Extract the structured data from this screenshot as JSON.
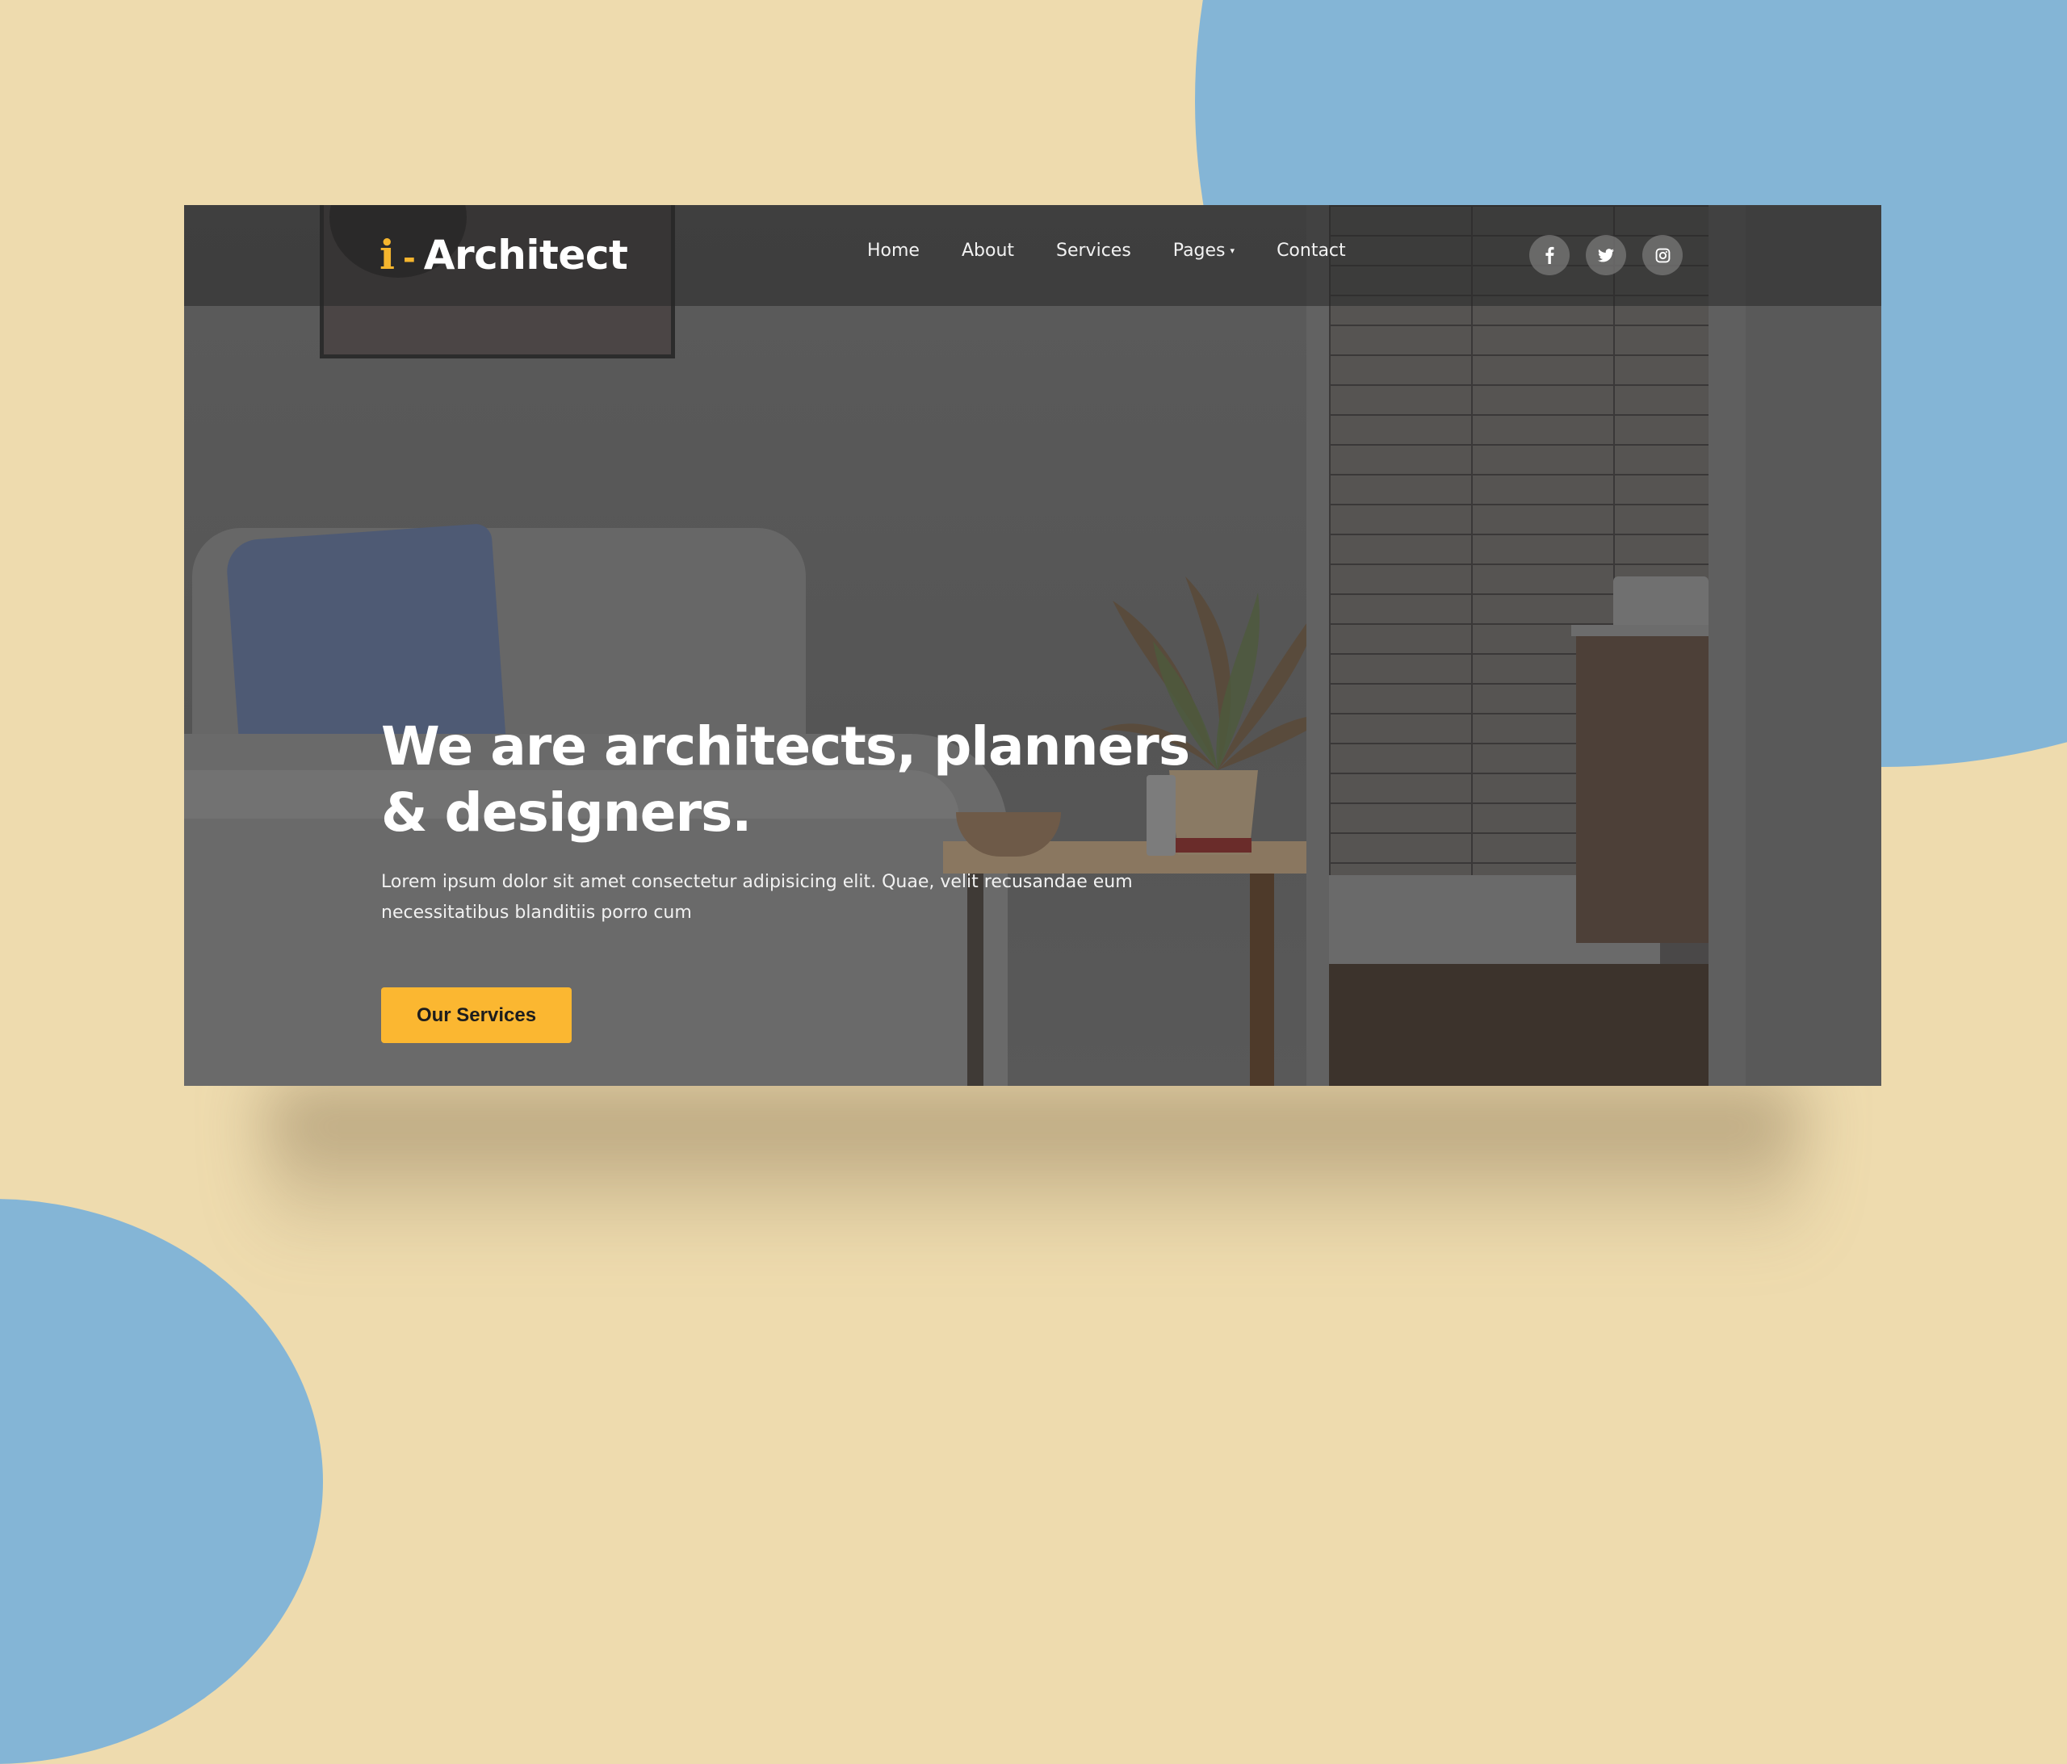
{
  "brand": {
    "logo_mark": "i",
    "logo_separator": "-",
    "name": "Architect",
    "accent_color": "#fbb731"
  },
  "nav": {
    "items": [
      {
        "label": "Home",
        "has_dropdown": false
      },
      {
        "label": "About",
        "has_dropdown": false
      },
      {
        "label": "Services",
        "has_dropdown": false
      },
      {
        "label": "Pages",
        "has_dropdown": true
      },
      {
        "label": "Contact",
        "has_dropdown": false
      }
    ],
    "dropdown_caret": "▾"
  },
  "social": [
    {
      "name": "facebook",
      "icon": "facebook-icon",
      "glyph": "f"
    },
    {
      "name": "twitter",
      "icon": "twitter-icon",
      "glyph": "t"
    },
    {
      "name": "instagram",
      "icon": "instagram-icon",
      "glyph": "ig"
    }
  ],
  "hero": {
    "title_line1": "We are architects, planners",
    "title_line2": "& designers.",
    "description": "Lorem ipsum dolor sit amet consectetur adipisicing elit. Quae, velit recusandae eum necessitatibus blanditiis porro cum",
    "cta_label": "Our Services"
  },
  "colors": {
    "page_background": "#eedbae",
    "blob": "#84b5d6",
    "button": "#fbb731"
  }
}
